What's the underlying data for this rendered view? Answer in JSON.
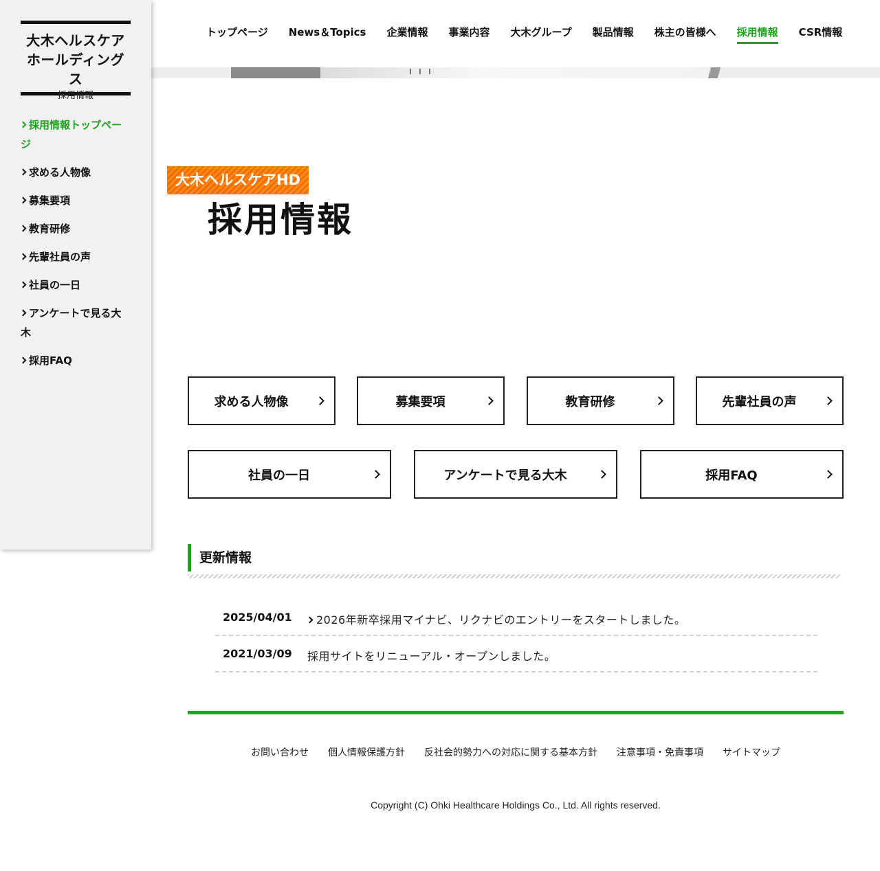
{
  "brand": {
    "line1": "大木ヘルスケア",
    "line2": "ホールディングス",
    "sub": "採用情報"
  },
  "sidebar": {
    "items": [
      {
        "label": "採用情報トップページ",
        "active": true
      },
      {
        "label": "求める人物像"
      },
      {
        "label": "募集要項"
      },
      {
        "label": "教育研修"
      },
      {
        "label": "先輩社員の声"
      },
      {
        "label": "社員の一日"
      },
      {
        "label": "アンケートで見る大木"
      },
      {
        "label": "採用FAQ"
      }
    ]
  },
  "topnav": {
    "items": [
      {
        "label": "トップページ"
      },
      {
        "label": "News＆Topics"
      },
      {
        "label": "企業情報"
      },
      {
        "label": "事業内容"
      },
      {
        "label": "大木グループ"
      },
      {
        "label": "製品情報"
      },
      {
        "label": "株主の皆様へ"
      },
      {
        "label": "採用情報",
        "active": true
      },
      {
        "label": "CSR情報"
      }
    ]
  },
  "hero": {
    "badge": "大木ヘルスケアHD",
    "title": "採用情報"
  },
  "links": {
    "row1": [
      "求める人物像",
      "募集要項",
      "教育研修",
      "先輩社員の声"
    ],
    "row2": [
      "社員の一日",
      "アンケートで見る大木",
      "採用FAQ"
    ]
  },
  "updates": {
    "heading": "更新情報",
    "items": [
      {
        "date": "2025/04/01",
        "text": "2026年新卒採用マイナビ、リクナビのエントリーをスタートしました。",
        "linked": true
      },
      {
        "date": "2021/03/09",
        "text": "採用サイトをリニューアル・オープンしました。",
        "linked": false
      }
    ]
  },
  "footer": {
    "links": [
      "お問い合わせ",
      "個人情報保護方針",
      "反社会的勢力への対応に関する基本方針",
      "注意事項・免責事項",
      "サイトマップ"
    ],
    "copyright": "Copyright (C) Ohki Healthcare Holdings Co., Ltd. All rights reserved."
  },
  "colors": {
    "accent": "#1ea31e",
    "badge": "#f26d00",
    "sidebar_bg": "#f1f1f1"
  }
}
